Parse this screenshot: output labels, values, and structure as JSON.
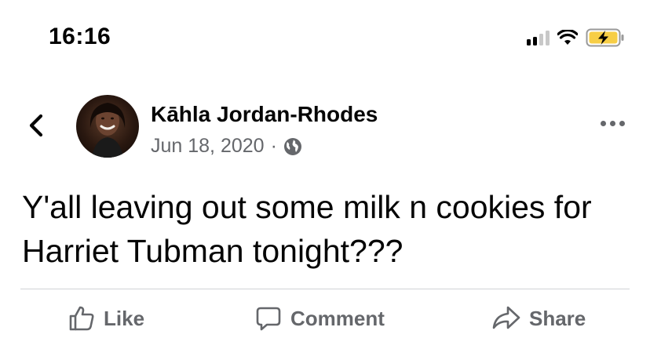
{
  "status_bar": {
    "time": "16:16",
    "icons": [
      "cellular-signal-icon",
      "wifi-icon",
      "battery-charging-icon"
    ],
    "battery_color": "#f7ce46"
  },
  "header": {
    "back_icon": "chevron-left-icon",
    "author_name": "Kāhla Jordan-Rhodes",
    "post_date": "Jun 18, 2020",
    "separator": "·",
    "privacy_icon": "globe-icon",
    "more_icon": "more-horizontal-icon"
  },
  "post": {
    "text": "Y'all leaving out some milk n cookies for Harriet Tubman tonight???"
  },
  "actions": {
    "like_label": "Like",
    "comment_label": "Comment",
    "share_label": "Share"
  },
  "colors": {
    "primary_text": "#050505",
    "secondary_text": "#65676b",
    "divider": "#d0d2d6"
  }
}
